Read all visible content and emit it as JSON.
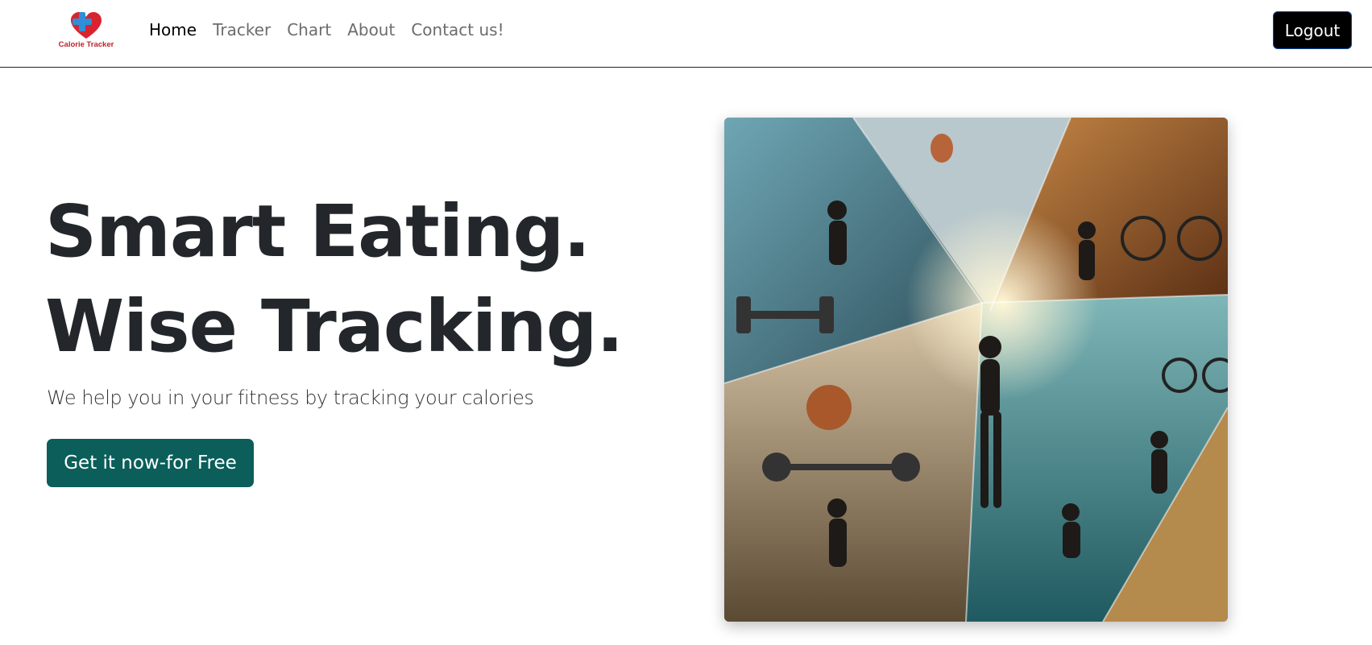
{
  "brand": {
    "name": "Calorie Tracker",
    "logo_colors": [
      "#2e8fd8",
      "#d8242f"
    ]
  },
  "nav": {
    "links": [
      {
        "label": "Home",
        "active": true
      },
      {
        "label": "Tracker",
        "active": false
      },
      {
        "label": "Chart",
        "active": false
      },
      {
        "label": "About",
        "active": false
      },
      {
        "label": "Contact us!",
        "active": false
      }
    ],
    "logout_label": "Logout"
  },
  "hero": {
    "title_line1": "Smart Eating.",
    "title_line2": "Wise Tracking.",
    "subtitle": "We help you in your fitness by tracking your calories",
    "cta_label": "Get it now-for Free",
    "cta_color": "#0b5e5a"
  },
  "image": {
    "subject": "fitness-collage",
    "icon_name": "fitness-collage-image"
  }
}
